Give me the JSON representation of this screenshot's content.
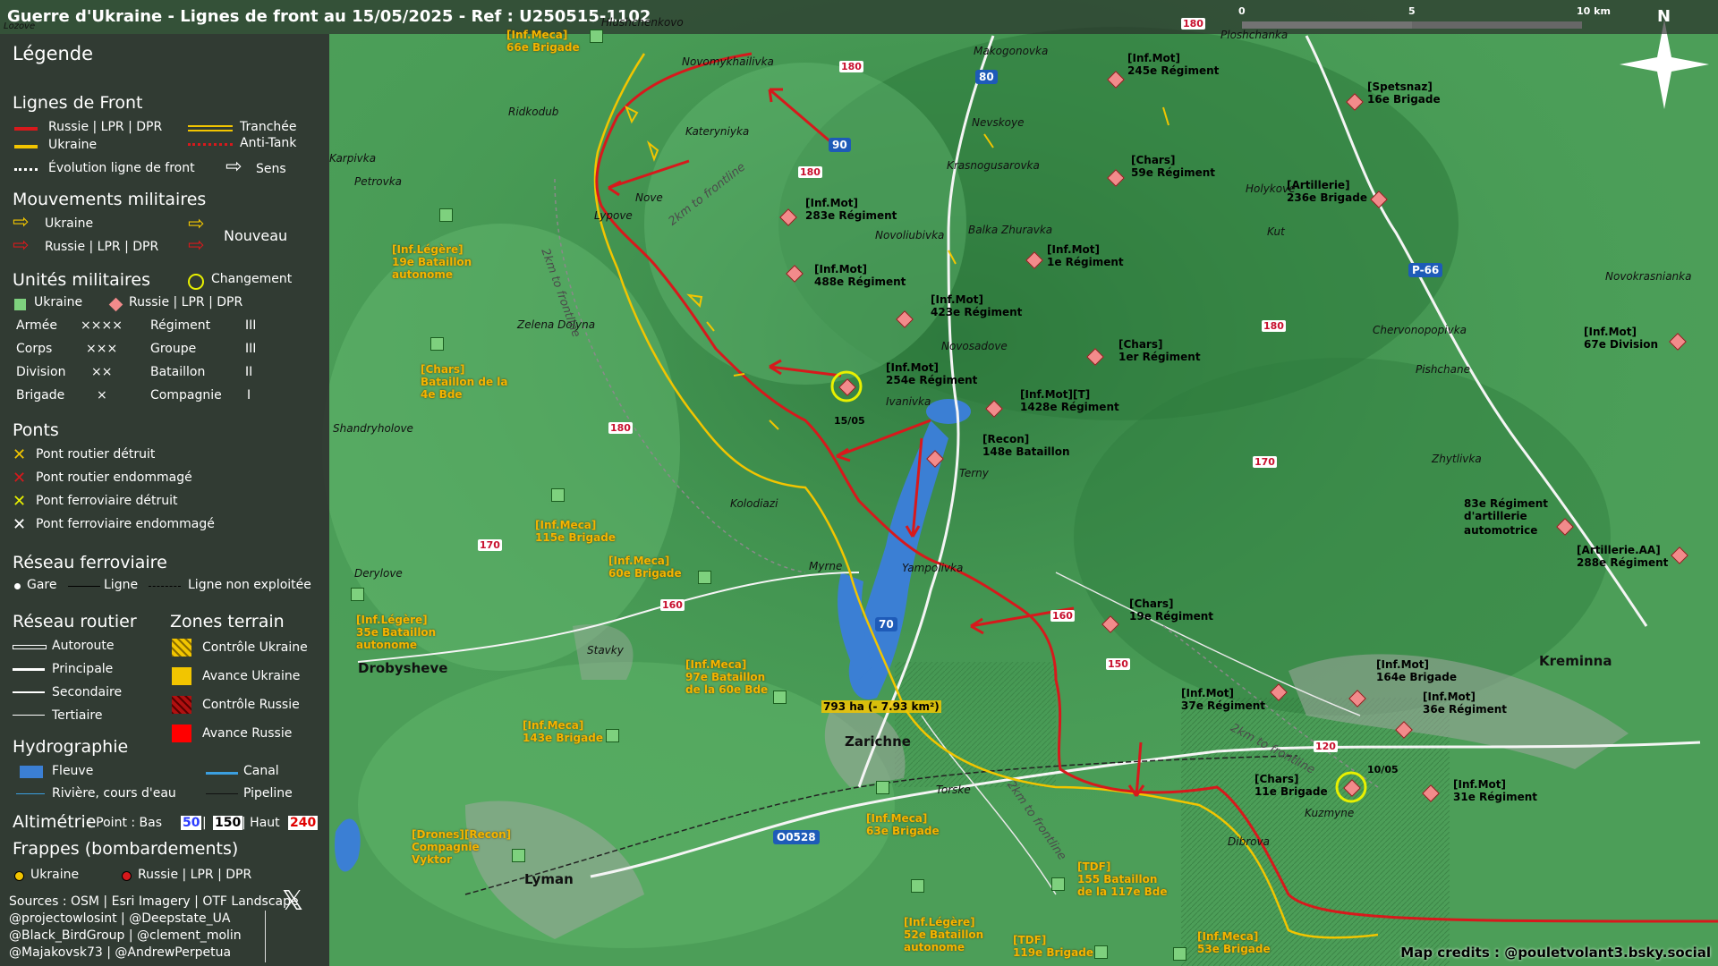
{
  "title": "Guerre d'Ukraine - Lignes de front au 15/05/2025 - Ref : U250515-1102",
  "scale": {
    "labels": [
      "0",
      "5",
      "10 km"
    ]
  },
  "north_label": "N",
  "legend": {
    "title": "Légende",
    "front": {
      "heading": "Lignes de Front",
      "russia": "Russie | LPR | DPR",
      "ukraine": "Ukraine",
      "evolution": "Évolution ligne de front",
      "trench": "Tranchée",
      "antitank": "Anti-Tank",
      "direction": "Sens"
    },
    "moves": {
      "heading": "Mouvements militaires",
      "ukraine": "Ukraine",
      "russia": "Russie | LPR | DPR",
      "new": "Nouveau"
    },
    "units": {
      "heading": "Unités militaires",
      "change": "Changement",
      "ukraine": "Ukraine",
      "russia": "Russie | LPR | DPR",
      "rows": [
        {
          "name": "Armée",
          "sym": "××××",
          "name2": "Régiment",
          "sym2": "III"
        },
        {
          "name": "Corps",
          "sym": "×××",
          "name2": "Groupe",
          "sym2": "III"
        },
        {
          "name": "Division",
          "sym": "××",
          "name2": "Bataillon",
          "sym2": "II"
        },
        {
          "name": "Brigade",
          "sym": "×",
          "name2": "Compagnie",
          "sym2": "I"
        }
      ]
    },
    "bridges": {
      "heading": "Ponts",
      "items": [
        "Pont routier détruit",
        "Pont routier endommagé",
        "Pont ferroviaire détruit",
        "Pont ferroviaire endommagé"
      ]
    },
    "rail": {
      "heading": "Réseau ferroviaire",
      "station": "Gare",
      "line": "Ligne",
      "unused": "Ligne non exploitée"
    },
    "road": {
      "heading": "Réseau routier",
      "items": [
        "Autoroute",
        "Principale",
        "Secondaire",
        "Tertiaire"
      ]
    },
    "zones": {
      "heading": "Zones terrain",
      "items": [
        "Contrôle Ukraine",
        "Avance Ukraine",
        "Contrôle Russie",
        "Avance Russie"
      ]
    },
    "hydro": {
      "heading": "Hydrographie",
      "river": "Fleuve",
      "canal": "Canal",
      "stream": "Rivière, cours d'eau",
      "pipeline": "Pipeline"
    },
    "alti": {
      "heading": "Altimétrie",
      "text1": " : Point : Bas ",
      "low": "50",
      "sep1": " | ",
      "mid": "150",
      "sep2": " | Haut ",
      "high": "240"
    },
    "strikes": {
      "heading": "Frappes (bombardements)",
      "ukraine": "Ukraine",
      "russia": "Russie | LPR | DPR"
    },
    "sources": {
      "line1": "Sources : OSM | Esri Imagery | OTF Landscape",
      "line2": "@projectowlosint | @Deepstate_UA",
      "line3": "@Black_BirdGroup | @clement_molin",
      "line4": "@Majakovsk73 | @AndrewPerpetua"
    }
  },
  "colors": {
    "russia": "#d7191c",
    "ukraine": "#f2c500",
    "water": "#3b7fd4",
    "unit_russia": "#f28b8b",
    "unit_ukraine": "#7ed17e"
  },
  "russian_units": [
    {
      "type": "[Inf.Mot]",
      "name": "245e Régiment"
    },
    {
      "type": "[Spetsnaz]",
      "name": "16e Brigade"
    },
    {
      "type": "[Chars]",
      "name": "59e Régiment"
    },
    {
      "type": "[Artillerie]",
      "name": "236e Brigade"
    },
    {
      "type": "[Inf.Mot]",
      "name": "283e Régiment"
    },
    {
      "type": "[Inf.Mot]",
      "name": "1e Régiment"
    },
    {
      "type": "[Inf.Mot]",
      "name": "488e Régiment"
    },
    {
      "type": "[Inf.Mot]",
      "name": "423e Régiment"
    },
    {
      "type": "[Chars]",
      "name": "1er Régiment"
    },
    {
      "type": "[Inf.Mot]",
      "name": "67e Division"
    },
    {
      "type": "[Inf.Mot]",
      "name": "254e Régiment"
    },
    {
      "type": "[Inf.Mot][T]",
      "name": "1428e Régiment"
    },
    {
      "type": "[Recon]",
      "name": "148e Bataillon"
    },
    {
      "type": "83e Régiment",
      "name": "d'artillerie"
    },
    {
      "type": "automotrice",
      "name": ""
    },
    {
      "type": "[Artillerie.AA]",
      "name": "288e Régiment"
    },
    {
      "type": "[Chars]",
      "name": "19e Régiment"
    },
    {
      "type": "[Inf.Mot]",
      "name": "164e Brigade"
    },
    {
      "type": "[Inf.Mot]",
      "name": "37e Régiment"
    },
    {
      "type": "[Inf.Mot]",
      "name": "36e Régiment"
    },
    {
      "type": "[Chars]",
      "name": "11e Brigade"
    },
    {
      "type": "[Inf.Mot]",
      "name": "31e Régiment"
    }
  ],
  "ukrainian_units": [
    {
      "type": "[Inf.Meca]",
      "name": "66e Brigade"
    },
    {
      "type": "[Inf.Légère]",
      "name": "19e Bataillon",
      "extra": "autonome"
    },
    {
      "type": "[Chars]",
      "name": "Bataillon de la",
      "extra": "4e Bde"
    },
    {
      "type": "[Inf.Meca]",
      "name": "115e Brigade"
    },
    {
      "type": "[Inf.Meca]",
      "name": "60e Brigade"
    },
    {
      "type": "[Inf.Légère]",
      "name": "35e Bataillon",
      "extra": "autonome"
    },
    {
      "type": "[Inf.Meca]",
      "name": "97e Bataillon",
      "extra": "de la 60e Bde"
    },
    {
      "type": "[Inf.Meca]",
      "name": "143e Brigade"
    },
    {
      "type": "[Inf.Meca]",
      "name": "63e Brigade"
    },
    {
      "type": "[Drones][Recon]",
      "name": "Compagnie",
      "extra": "Vyktor"
    },
    {
      "type": "[TDF]",
      "name": "155 Bataillon",
      "extra": "de la 117e Bde"
    },
    {
      "type": "[Inf.Légère]",
      "name": "52e Bataillon",
      "extra": "autonome"
    },
    {
      "type": "[TDF]",
      "name": "119e Brigade"
    },
    {
      "type": "[Inf.Meca]",
      "name": "53e Brigade"
    }
  ],
  "places": [
    "Novomykhailivka",
    "Kateryniyka",
    "Ridkodub",
    "Karpivka",
    "Petrovka",
    "Nove",
    "Lypove",
    "Zelena Dolyna",
    "Shandryholove",
    "Kolodiazi",
    "Derylove",
    "Myrne",
    "Yampolivka",
    "Stavky",
    "Makogonovka",
    "Nevskoye",
    "Krasnogusarovka",
    "Novoliubivka",
    "Balka Zhuravka",
    "Novosadove",
    "Ivanivka",
    "Terny",
    "Holykove",
    "Kut",
    "Novokrasnianka",
    "Chervonopopivka",
    "Pishchane",
    "Zhytlivka",
    "Kuzmyne",
    "Dibrova",
    "Torske",
    "Ploshchanka",
    "Hlushchenkovo"
  ],
  "big_places": [
    "Drobysheve",
    "Zarichne",
    "Lyman",
    "Kreminna"
  ],
  "frontline_labels": [
    "2km to frontline",
    "2km to frontline",
    "2km to frontline",
    "2km to frontline"
  ],
  "roads": [
    "180",
    "180",
    "180",
    "180",
    "180",
    "180",
    "170",
    "170",
    "160",
    "160",
    "150",
    "120"
  ],
  "shields": [
    "80",
    "90",
    "70",
    "P-66",
    "O0528"
  ],
  "dates": [
    "15/05",
    "10/05"
  ],
  "area_label": "793 ha (- 7.93 km²)",
  "credits": "Map credits : @pouletvolant3.bsky.social",
  "lozove": "Lozove"
}
